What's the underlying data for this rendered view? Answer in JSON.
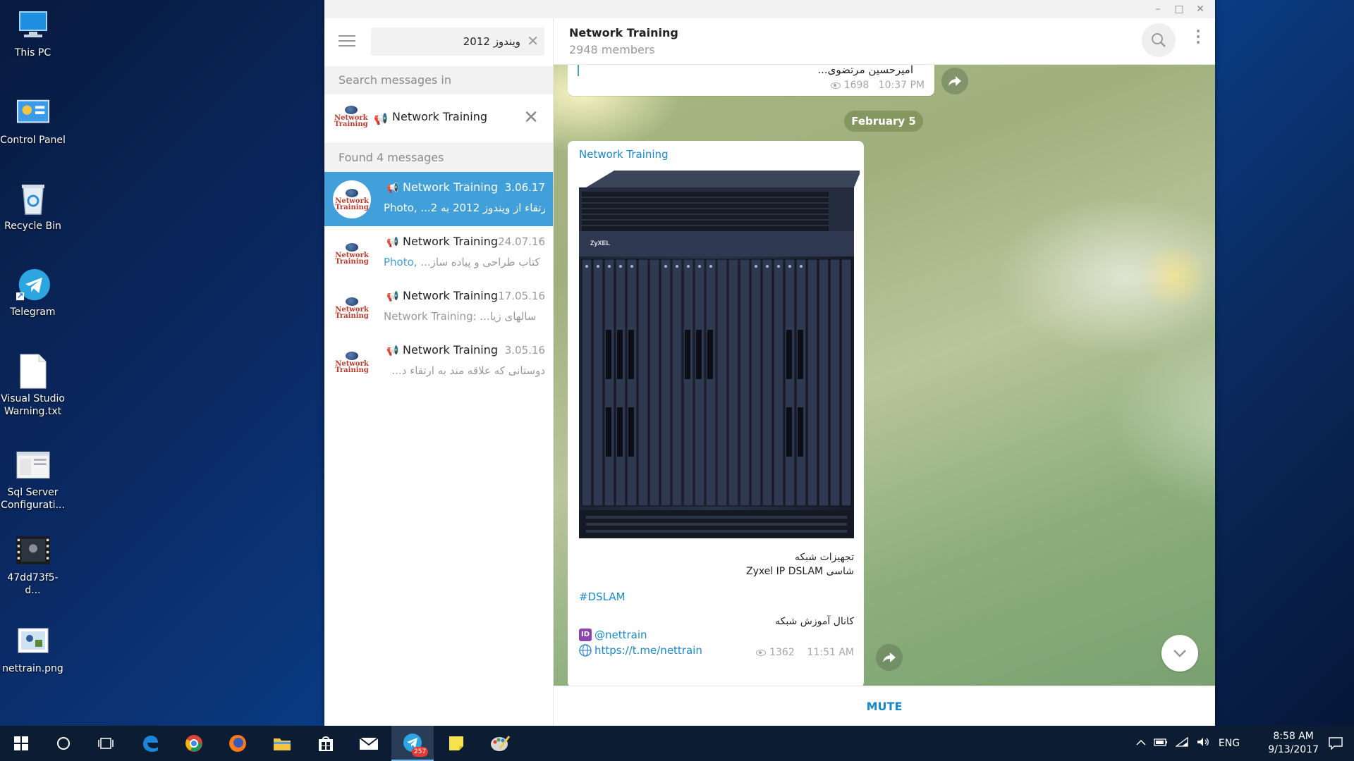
{
  "desktop": {
    "icons": [
      {
        "label": "This PC",
        "icon": "computer-icon"
      },
      {
        "label": "Control Panel",
        "icon": "control-panel-icon"
      },
      {
        "label": "Recycle Bin",
        "icon": "recycle-bin-icon"
      },
      {
        "label": "Telegram",
        "icon": "telegram-icon"
      },
      {
        "label": "Visual Studio Warning.txt",
        "icon": "text-file-icon"
      },
      {
        "label": "Sql Server Configurati...",
        "icon": "sql-config-icon"
      },
      {
        "label": "47dd73f5-d...",
        "icon": "video-file-icon"
      },
      {
        "label": "nettrain.png",
        "icon": "image-file-icon"
      }
    ]
  },
  "window": {
    "controls": {
      "minimize": "–",
      "maximize": "□",
      "close": "✕"
    }
  },
  "left": {
    "search_value": "ویندوز 2012",
    "clear": "✕",
    "search_in_label": "Search messages in",
    "scope": {
      "name": "Network Training",
      "remove": "✕"
    },
    "found_label": "Found 4 messages",
    "results": [
      {
        "name": "Network Training",
        "date": "3.06.17",
        "prefix": "Photo, ",
        "text": "ارتقاء از ویندوز 2012 به 2...",
        "active": true
      },
      {
        "name": "Network Training",
        "date": "24.07.16",
        "prefix": "Photo, ",
        "text": "کتاب طراحی و پیاده ساز...",
        "active": false
      },
      {
        "name": "Network Training",
        "date": "17.05.16",
        "prefix": "Network Training: ",
        "text": "سالهای زیا...",
        "active": false
      },
      {
        "name": "Network Training",
        "date": "3.05.16",
        "prefix": "",
        "text": "دوستانی که علاقه مند به ارتقاء د...",
        "active": false
      }
    ]
  },
  "chat": {
    "title": "Network Training",
    "members": "2948 members",
    "prev_message": {
      "text": "امیرحسین مرتضوی...",
      "views": "1698",
      "time": "10:37 PM"
    },
    "date_divider": "February 5",
    "message": {
      "author": "Network Training",
      "product_brand": "ZyXEL",
      "caption_line1": "تجهیزات شبکه",
      "caption_line2": "شاسی Zyxel IP DSLAM",
      "hashtag": "#DSLAM",
      "channel_line": "کانال آموزش شبکه",
      "id_badge": "ID",
      "handle": "@nettrain",
      "link": "https://t.me/nettrain",
      "views": "1362",
      "time": "11:51 AM"
    },
    "mute_label": "MUTE"
  },
  "taskbar": {
    "telegram_badge": "257",
    "lang": "ENG",
    "time": "8:58 AM",
    "date": "9/13/2017"
  },
  "colors": {
    "accent": "#419fd9",
    "link": "#168acd",
    "taskbar": "#0c1c33"
  }
}
